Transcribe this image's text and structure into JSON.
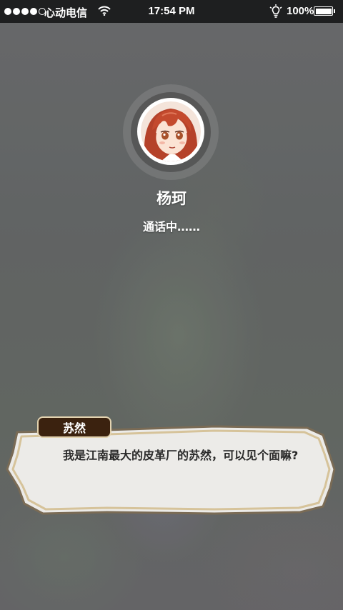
{
  "status_bar": {
    "carrier": "心动电信",
    "time": "17:54 PM",
    "battery": "100%",
    "signal_bars": 4,
    "signal_total": 5,
    "icons": [
      "wifi-icon",
      "lightbulb-icon",
      "battery-icon"
    ]
  },
  "call": {
    "caller_name": "杨珂",
    "status": "通话中……"
  },
  "dialogue": {
    "speaker": "苏然",
    "text": "我是江南最大的皮革厂的苏然，可以见个面嘛?"
  },
  "colors": {
    "status_bar_bg": "#1e1f20",
    "speaker_tag_bg": "#3b220f",
    "dialogue_bg": "#ecebe8",
    "dialogue_border": "#d6c39a"
  }
}
